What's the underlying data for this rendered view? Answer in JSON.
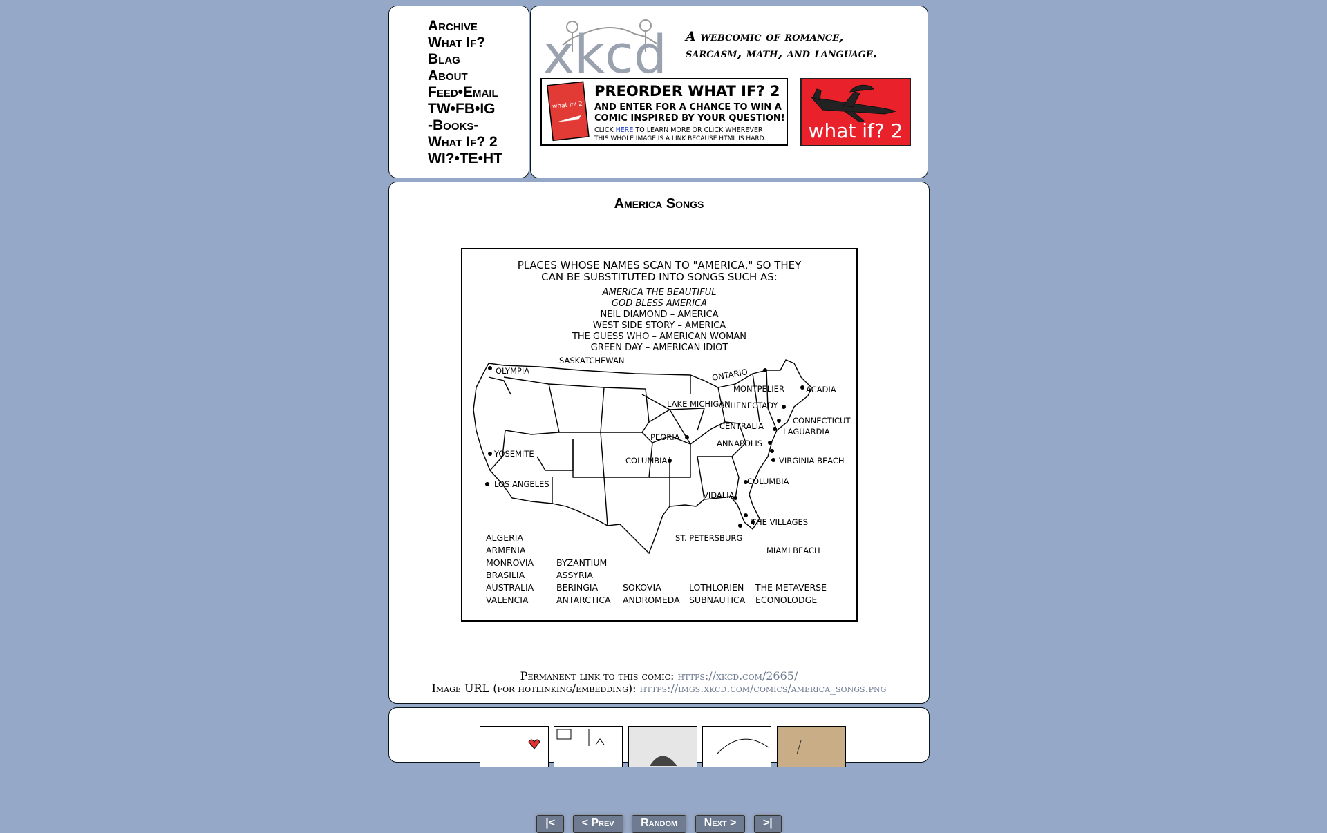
{
  "nav": {
    "items": [
      "Archive",
      "What If?",
      "Blag",
      "About",
      "Feed•Email",
      "TW•FB•IG",
      "-Books-",
      "What If? 2",
      "WI?•TE•HT"
    ]
  },
  "header": {
    "logo_text": "xkcd",
    "slogan_line1": "A webcomic of romance,",
    "slogan_line2": "sarcasm, math, and language."
  },
  "ad": {
    "preorder_line1": "PREORDER WHAT IF? 2",
    "preorder_line2": "AND ENTER FOR A CHANCE TO WIN A",
    "preorder_line3": "COMIC INSPIRED BY YOUR QUESTION!",
    "preorder_line4a": "CLICK",
    "preorder_here": "HERE",
    "preorder_line4b": "TO LEARN MORE OR CLICK WHEREVER",
    "preorder_line5": "THIS WHOLE IMAGE IS A LINK BECAUSE HTML IS HARD.",
    "book_cover_text": "what if? 2",
    "what_if_2_label": "what if? 2"
  },
  "comic": {
    "title": "America Songs",
    "nav": {
      "first": "|<",
      "prev": "< Prev",
      "random": "Random",
      "next": "Next >",
      "last": ">|"
    },
    "heading1": "PLACES WHOSE NAMES SCAN TO \"AMERICA,\" SO THEY",
    "heading2": "CAN BE SUBSTITUTED INTO SONGS SUCH AS:",
    "songs": [
      "AMERICA THE BEAUTIFUL",
      "GOD BLESS AMERICA",
      "NEIL DIAMOND – AMERICA",
      "WEST SIDE STORY – AMERICA",
      "THE GUESS WHO – AMERICAN WOMAN",
      "GREEN DAY – AMERICAN IDIOT"
    ],
    "map_labels": {
      "saskatchewan": "SASKATCHEWAN",
      "ontario": "ONTARIO",
      "olympia": "OLYMPIA",
      "montpelier": "MONTPELIER",
      "acadia": "ACADIA",
      "lake_michigan": "LAKE MICHIGAN",
      "schenectady": "SCHENECTADY",
      "connecticut": "CONNECTICUT",
      "laguardia": "LAGUARDIA",
      "centralia": "CENTRALIA",
      "peoria": "PEORIA",
      "annapolis": "ANNAPOLIS",
      "yosemite": "YOSEMITE",
      "columbia_mo": "COLUMBIA",
      "virginia_beach": "VIRGINIA BEACH",
      "los_angeles": "LOS ANGELES",
      "columbia_sc": "COLUMBIA",
      "vidalia": "VIDALIA",
      "the_villages": "THE VILLAGES",
      "st_petersburg": "ST. PETERSBURG",
      "miami_beach": "MIAMI BEACH"
    },
    "list_col1": [
      "ALGERIA",
      "ARMENIA",
      "MONROVIA",
      "BRASILIA",
      "AUSTRALIA",
      "VALENCIA"
    ],
    "list_col2": [
      "BYZANTIUM",
      "ASSYRIA",
      "BERINGIA",
      "ANTARCTICA"
    ],
    "list_col3": [
      "SOKOVIA",
      "ANDROMEDA"
    ],
    "list_col4": [
      "LOTHLORIEN",
      "SUBNAUTICA"
    ],
    "list_col5": [
      "THE METAVERSE",
      "ECONOLODGE"
    ]
  },
  "links": {
    "permanent_label": "Permanent link to this comic:",
    "permanent_url": "https://xkcd.com/2665/",
    "image_label": "Image URL (for hotlinking/embedding):",
    "image_url": "https://imgs.xkcd.com/comics/america_songs.png"
  }
}
